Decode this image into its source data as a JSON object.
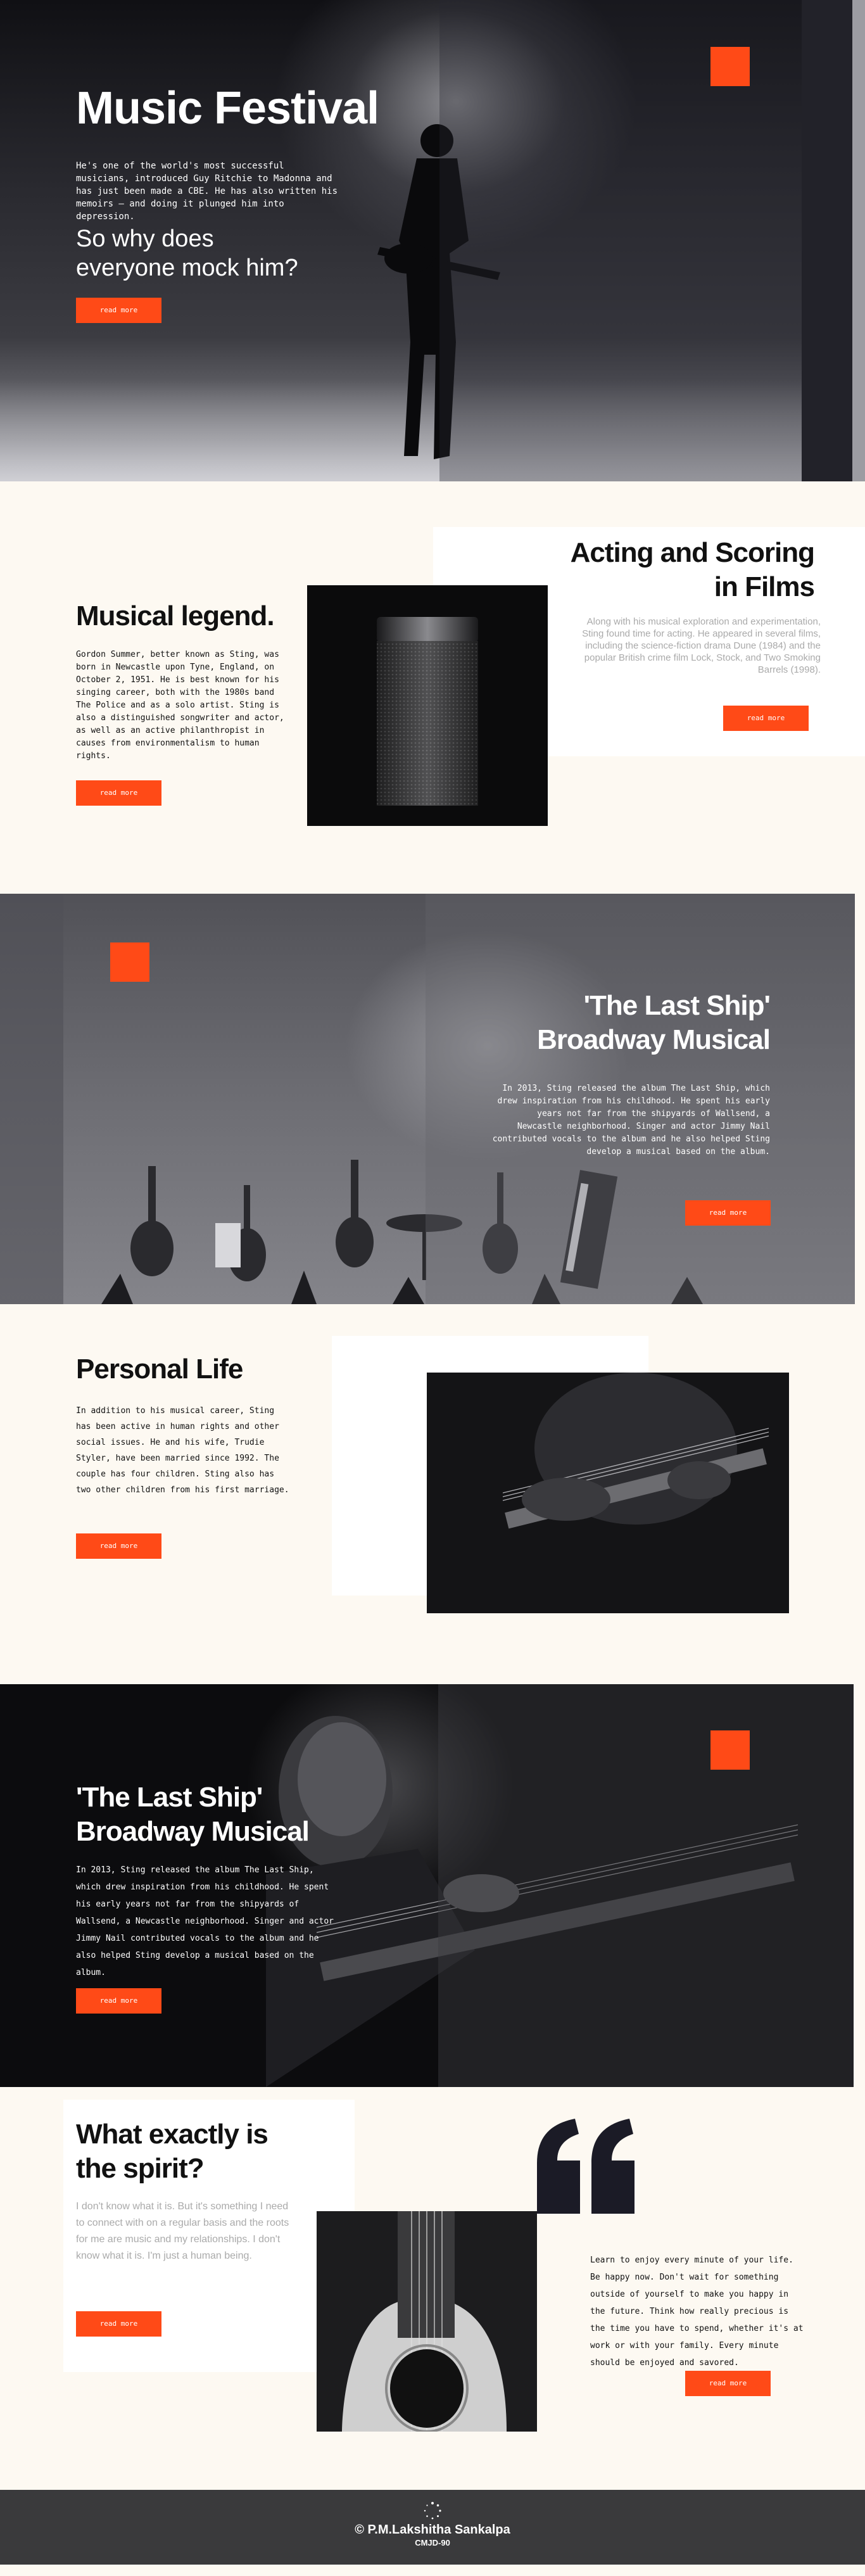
{
  "colors": {
    "accent": "#ff4a17",
    "cream": "#fdf9f2",
    "dark": "#16151c",
    "footer": "#3a3a3c"
  },
  "hero": {
    "title": "Music Festival",
    "intro": "He's one of the world's most successful musicians, introduced Guy Ritchie to Madonna and has just been made a CBE. He has also written his memoirs – and doing it plunged him into depression.",
    "subtitle": "So why does everyone mock him?",
    "button": "read more"
  },
  "legend": {
    "title": "Musical legend.",
    "text": "Gordon Summer, better known as Sting, was born in Newcastle upon Tyne, England, on October 2, 1951. He is best known for his singing career, both with the 1980s band The Police and as a solo artist. Sting is also a distinguished songwriter and actor, as well as an active philanthropist in causes from environmentalism to human rights.",
    "button": "read more"
  },
  "films": {
    "title": "Acting and Scoring in Films",
    "text": "Along with his musical exploration and experimentation, Sting found time for acting. He appeared in several films, including the science-fiction drama Dune (1984) and the popular British crime film Lock, Stock, and Two Smoking Barrels (1998).",
    "button": "read more"
  },
  "ship1": {
    "title": "'The Last Ship' Broadway Musical",
    "text": "In 2013, Sting released the album The Last Ship, which drew inspiration from his childhood. He spent his early years not far from the shipyards of Wallsend, a Newcastle neighborhood. Singer and actor Jimmy Nail contributed vocals to the album and he also helped Sting develop a musical based on the album.",
    "button": "read more"
  },
  "personal": {
    "title": "Personal Life",
    "text": "In addition to his musical career, Sting has been active in human rights and other social issues. He and his wife, Trudie Styler, have been married since 1992. The couple has four children. Sting also has two other children from his first marriage.",
    "button": "read more"
  },
  "ship2": {
    "title": "'The Last Ship' Broadway Musical",
    "text": "In 2013, Sting released the album The Last Ship, which drew inspiration from his childhood. He spent his early years not far from the shipyards of Wallsend, a Newcastle neighborhood. Singer and actor Jimmy Nail contributed vocals to the album and he also helped Sting develop a musical based on the album.",
    "button": "read more"
  },
  "spirit": {
    "title": "What exactly is the spirit?",
    "text": "I don't know what it is. But it's something I need to connect with on a regular basis and the roots for me are music and my relationships. I don't know what it is. I'm just a human being.",
    "button": "read more",
    "quote_text": "Learn to enjoy every minute of your life. Be happy now. Don't wait for something outside of yourself to make you happy in the future. Think how really precious is the time you have to spend, whether it's at work or with your family. Every minute should be enjoyed and savored.",
    "quote_button": "read more"
  },
  "footer": {
    "name": "© P.M.Lakshitha Sankalpa",
    "code": "CMJD-90"
  }
}
